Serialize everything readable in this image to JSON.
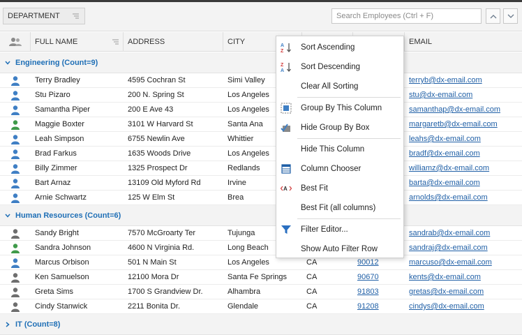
{
  "toolbar": {
    "group_label": "DEPARTMENT",
    "search_placeholder": "Search Employees (Ctrl + F)"
  },
  "columns": {
    "name": "FULL NAME",
    "address": "ADDRESS",
    "city": "CITY",
    "email": "EMAIL"
  },
  "groups": [
    {
      "title": "Engineering (Count=9)",
      "expanded": true,
      "rows": [
        {
          "name": "Terry Bradley",
          "address": "4595 Cochran St",
          "city": "Simi Valley",
          "state": "",
          "zip": "",
          "email": "terryb@dx-email.com",
          "avatar_color": "#3f7fc4"
        },
        {
          "name": "Stu Pizaro",
          "address": "200 N. Spring St",
          "city": "Los Angeles",
          "state": "",
          "zip": "",
          "email": "stu@dx-email.com",
          "avatar_color": "#3f7fc4"
        },
        {
          "name": "Samantha Piper",
          "address": "200 E Ave 43",
          "city": "Los Angeles",
          "state": "",
          "zip": "",
          "email": "samanthap@dx-email.com",
          "avatar_color": "#3f7fc4"
        },
        {
          "name": "Maggie Boxter",
          "address": "3101 W Harvard St",
          "city": "Santa Ana",
          "state": "",
          "zip": "",
          "email": "margaretb@dx-email.com",
          "avatar_color": "#3f9a4a"
        },
        {
          "name": "Leah Simpson",
          "address": "6755 Newlin Ave",
          "city": "Whittier",
          "state": "",
          "zip": "",
          "email": "leahs@dx-email.com",
          "avatar_color": "#3f7fc4"
        },
        {
          "name": "Brad Farkus",
          "address": "1635 Woods Drive",
          "city": "Los Angeles",
          "state": "",
          "zip": "",
          "email": "bradf@dx-email.com",
          "avatar_color": "#3f7fc4"
        },
        {
          "name": "Billy Zimmer",
          "address": "1325 Prospect Dr",
          "city": "Redlands",
          "state": "",
          "zip": "",
          "email": "williamz@dx-email.com",
          "avatar_color": "#3f7fc4"
        },
        {
          "name": "Bart Arnaz",
          "address": "13109 Old Myford Rd",
          "city": "Irvine",
          "state": "",
          "zip": "",
          "email": "barta@dx-email.com",
          "avatar_color": "#3f7fc4"
        },
        {
          "name": "Arnie Schwartz",
          "address": "125 W Elm St",
          "city": "Brea",
          "state": "",
          "zip": "",
          "email": "arnolds@dx-email.com",
          "avatar_color": "#3f7fc4"
        }
      ]
    },
    {
      "title": "Human Resources (Count=6)",
      "expanded": true,
      "rows": [
        {
          "name": "Sandy Bright",
          "address": "7570 McGroarty Ter",
          "city": "Tujunga",
          "state": "",
          "zip": "",
          "email": "sandrab@dx-email.com",
          "avatar_color": "#6e6e6e"
        },
        {
          "name": "Sandra Johnson",
          "address": "4600 N Virginia Rd.",
          "city": "Long Beach",
          "state": "",
          "zip": "",
          "email": "sandraj@dx-email.com",
          "avatar_color": "#3f9a4a"
        },
        {
          "name": "Marcus Orbison",
          "address": "501 N Main St",
          "city": "Los Angeles",
          "state": "CA",
          "zip": "90012",
          "email": "marcuso@dx-email.com",
          "avatar_color": "#3f7fc4"
        },
        {
          "name": "Ken Samuelson",
          "address": "12100 Mora Dr",
          "city": "Santa Fe Springs",
          "state": "CA",
          "zip": "90670",
          "email": "kents@dx-email.com",
          "avatar_color": "#6e6e6e"
        },
        {
          "name": "Greta Sims",
          "address": "1700 S Grandview Dr.",
          "city": "Alhambra",
          "state": "CA",
          "zip": "91803",
          "email": "gretas@dx-email.com",
          "avatar_color": "#6e6e6e"
        },
        {
          "name": "Cindy Stanwick",
          "address": "2211 Bonita Dr.",
          "city": "Glendale",
          "state": "CA",
          "zip": "91208",
          "email": "cindys@dx-email.com",
          "avatar_color": "#6e6e6e"
        }
      ]
    },
    {
      "title": "IT (Count=8)",
      "expanded": false,
      "rows": []
    }
  ],
  "context_menu": {
    "items": [
      {
        "id": "sort-ascending",
        "label": "Sort Ascending",
        "icon": "sort-ascending-icon",
        "sep_after": false
      },
      {
        "id": "sort-descending",
        "label": "Sort Descending",
        "icon": "sort-descending-icon",
        "sep_after": false
      },
      {
        "id": "clear-all-sorting",
        "label": "Clear All Sorting",
        "icon": "",
        "sep_after": true
      },
      {
        "id": "group-by-this-column",
        "label": "Group By This Column",
        "icon": "group-by-icon",
        "sep_after": false
      },
      {
        "id": "hide-group-by-box",
        "label": "Hide Group By Box",
        "icon": "hide-group-box-icon",
        "sep_after": true
      },
      {
        "id": "hide-this-column",
        "label": "Hide This Column",
        "icon": "",
        "sep_after": false
      },
      {
        "id": "column-chooser",
        "label": "Column Chooser",
        "icon": "column-chooser-icon",
        "sep_after": false
      },
      {
        "id": "best-fit",
        "label": "Best Fit",
        "icon": "best-fit-icon",
        "sep_after": false
      },
      {
        "id": "best-fit-all",
        "label": "Best Fit (all columns)",
        "icon": "",
        "sep_after": true
      },
      {
        "id": "filter-editor",
        "label": "Filter Editor...",
        "icon": "filter-editor-icon",
        "sep_after": false
      },
      {
        "id": "show-auto-filter-row",
        "label": "Show Auto Filter Row",
        "icon": "",
        "sep_after": false
      }
    ]
  },
  "colors": {
    "group_text": "#1f6fb6",
    "link": "#1f5fa6",
    "icon_blue": "#3f7fc4",
    "icon_red": "#d13b3b"
  }
}
